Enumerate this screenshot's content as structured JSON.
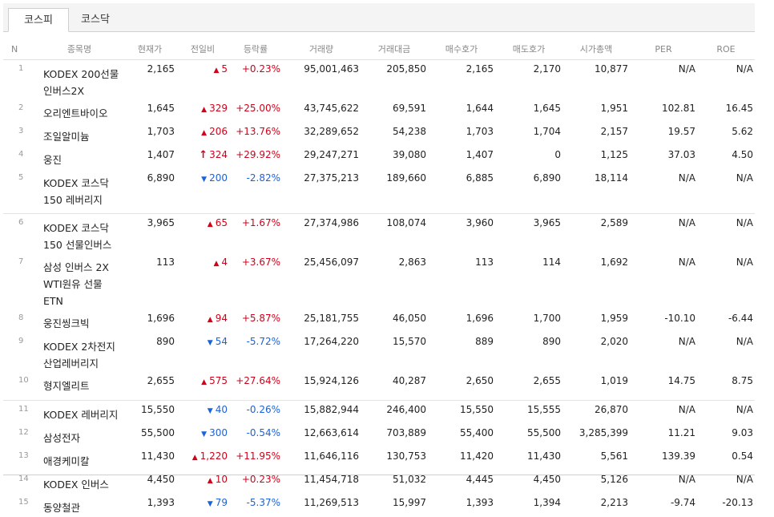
{
  "tabs": [
    {
      "label": "코스피",
      "active": true
    },
    {
      "label": "코스닥",
      "active": false
    }
  ],
  "columns": [
    "N",
    "종목명",
    "현재가",
    "전일비",
    "등락률",
    "거래량",
    "거래대금",
    "매수호가",
    "매도호가",
    "시가총액",
    "PER",
    "ROE"
  ],
  "colors": {
    "up": "#d0021b",
    "down": "#1c62d8"
  },
  "rows": [
    {
      "n": "1",
      "name": "KODEX 200선물인버스2X",
      "price": "2,165",
      "dir": "up",
      "change": "5",
      "rate": "+0.23%",
      "volume": "95,001,463",
      "amount": "205,850",
      "bid": "2,165",
      "ask": "2,170",
      "cap": "10,877",
      "per": "N/A",
      "roe": "N/A"
    },
    {
      "n": "2",
      "name": "오리엔트바이오",
      "price": "1,645",
      "dir": "up",
      "change": "329",
      "rate": "+25.00%",
      "volume": "43,745,622",
      "amount": "69,591",
      "bid": "1,644",
      "ask": "1,645",
      "cap": "1,951",
      "per": "102.81",
      "roe": "16.45"
    },
    {
      "n": "3",
      "name": "조일알미늄",
      "price": "1,703",
      "dir": "up",
      "change": "206",
      "rate": "+13.76%",
      "volume": "32,289,652",
      "amount": "54,238",
      "bid": "1,703",
      "ask": "1,704",
      "cap": "2,157",
      "per": "19.57",
      "roe": "5.62"
    },
    {
      "n": "4",
      "name": "웅진",
      "price": "1,407",
      "dir": "limit-up",
      "change": "324",
      "rate": "+29.92%",
      "volume": "29,247,271",
      "amount": "39,080",
      "bid": "1,407",
      "ask": "0",
      "cap": "1,125",
      "per": "37.03",
      "roe": "4.50"
    },
    {
      "n": "5",
      "name": "KODEX 코스닥150 레버리지",
      "price": "6,890",
      "dir": "down",
      "change": "200",
      "rate": "-2.82%",
      "volume": "27,375,213",
      "amount": "189,660",
      "bid": "6,885",
      "ask": "6,890",
      "cap": "18,114",
      "per": "N/A",
      "roe": "N/A"
    },
    {
      "n": "6",
      "name": "KODEX 코스닥150 선물인버스",
      "price": "3,965",
      "dir": "up",
      "change": "65",
      "rate": "+1.67%",
      "volume": "27,374,986",
      "amount": "108,074",
      "bid": "3,960",
      "ask": "3,965",
      "cap": "2,589",
      "per": "N/A",
      "roe": "N/A"
    },
    {
      "n": "7",
      "name": "삼성 인버스 2X WTI원유 선물 ETN",
      "price": "113",
      "dir": "up",
      "change": "4",
      "rate": "+3.67%",
      "volume": "25,456,097",
      "amount": "2,863",
      "bid": "113",
      "ask": "114",
      "cap": "1,692",
      "per": "N/A",
      "roe": "N/A"
    },
    {
      "n": "8",
      "name": "웅진씽크빅",
      "price": "1,696",
      "dir": "up",
      "change": "94",
      "rate": "+5.87%",
      "volume": "25,181,755",
      "amount": "46,050",
      "bid": "1,696",
      "ask": "1,700",
      "cap": "1,959",
      "per": "-10.10",
      "roe": "-6.44"
    },
    {
      "n": "9",
      "name": "KODEX 2차전지산업레버리지",
      "price": "890",
      "dir": "down",
      "change": "54",
      "rate": "-5.72%",
      "volume": "17,264,220",
      "amount": "15,570",
      "bid": "889",
      "ask": "890",
      "cap": "2,020",
      "per": "N/A",
      "roe": "N/A"
    },
    {
      "n": "10",
      "name": "형지엘리트",
      "price": "2,655",
      "dir": "up",
      "change": "575",
      "rate": "+27.64%",
      "volume": "15,924,126",
      "amount": "40,287",
      "bid": "2,650",
      "ask": "2,655",
      "cap": "1,019",
      "per": "14.75",
      "roe": "8.75"
    },
    {
      "n": "11",
      "name": "KODEX 레버리지",
      "price": "15,550",
      "dir": "down",
      "change": "40",
      "rate": "-0.26%",
      "volume": "15,882,944",
      "amount": "246,400",
      "bid": "15,550",
      "ask": "15,555",
      "cap": "26,870",
      "per": "N/A",
      "roe": "N/A"
    },
    {
      "n": "12",
      "name": "삼성전자",
      "price": "55,500",
      "dir": "down",
      "change": "300",
      "rate": "-0.54%",
      "volume": "12,663,614",
      "amount": "703,889",
      "bid": "55,400",
      "ask": "55,500",
      "cap": "3,285,399",
      "per": "11.21",
      "roe": "9.03"
    },
    {
      "n": "13",
      "name": "애경케미칼",
      "price": "11,430",
      "dir": "up",
      "change": "1,220",
      "rate": "+11.95%",
      "volume": "11,646,116",
      "amount": "130,753",
      "bid": "11,420",
      "ask": "11,430",
      "cap": "5,561",
      "per": "139.39",
      "roe": "0.54"
    },
    {
      "n": "14",
      "name": "KODEX 인버스",
      "price": "4,450",
      "dir": "up",
      "change": "10",
      "rate": "+0.23%",
      "volume": "11,454,718",
      "amount": "51,032",
      "bid": "4,445",
      "ask": "4,450",
      "cap": "5,126",
      "per": "N/A",
      "roe": "N/A"
    },
    {
      "n": "15",
      "name": "동양철관",
      "price": "1,393",
      "dir": "down",
      "change": "79",
      "rate": "-5.37%",
      "volume": "11,269,513",
      "amount": "15,997",
      "bid": "1,393",
      "ask": "1,394",
      "cap": "2,213",
      "per": "-9.74",
      "roe": "-20.13"
    }
  ]
}
